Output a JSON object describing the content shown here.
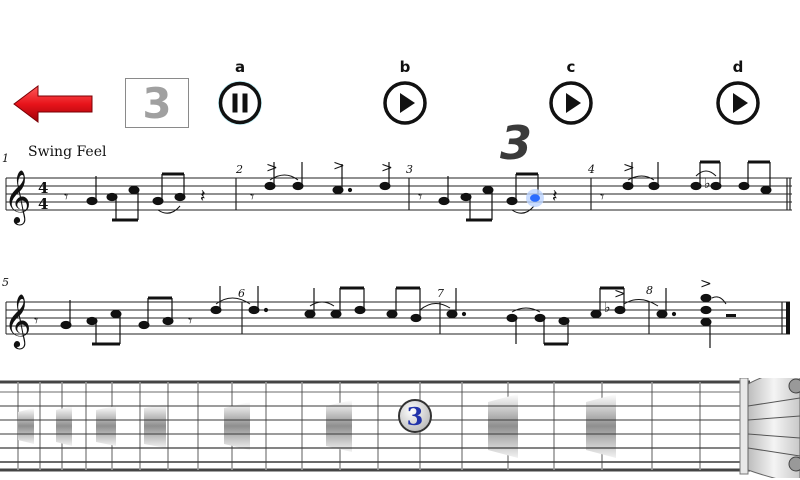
{
  "toolbar": {
    "counter_value": "3",
    "controls": [
      {
        "label": "a",
        "state": "pause"
      },
      {
        "label": "b",
        "state": "play"
      },
      {
        "label": "c",
        "state": "play"
      },
      {
        "label": "d",
        "state": "play"
      }
    ]
  },
  "score": {
    "tempo_marking": "Swing Feel",
    "time_signature": "4/4",
    "measure_numbers": [
      "1",
      "2",
      "3",
      "4",
      "5",
      "6",
      "7",
      "8"
    ],
    "beat_count": "3"
  },
  "fretboard": {
    "finger_marker": "3"
  },
  "colors": {
    "back_arrow": "#e8141b",
    "active_glow": "#5fd6ee",
    "note_highlight": "#2b6cff",
    "marker_text": "#2233aa"
  },
  "icons": [
    "back-arrow-icon",
    "pause-icon",
    "play-icon",
    "treble-clef-icon",
    "guitar-headstock-icon"
  ]
}
